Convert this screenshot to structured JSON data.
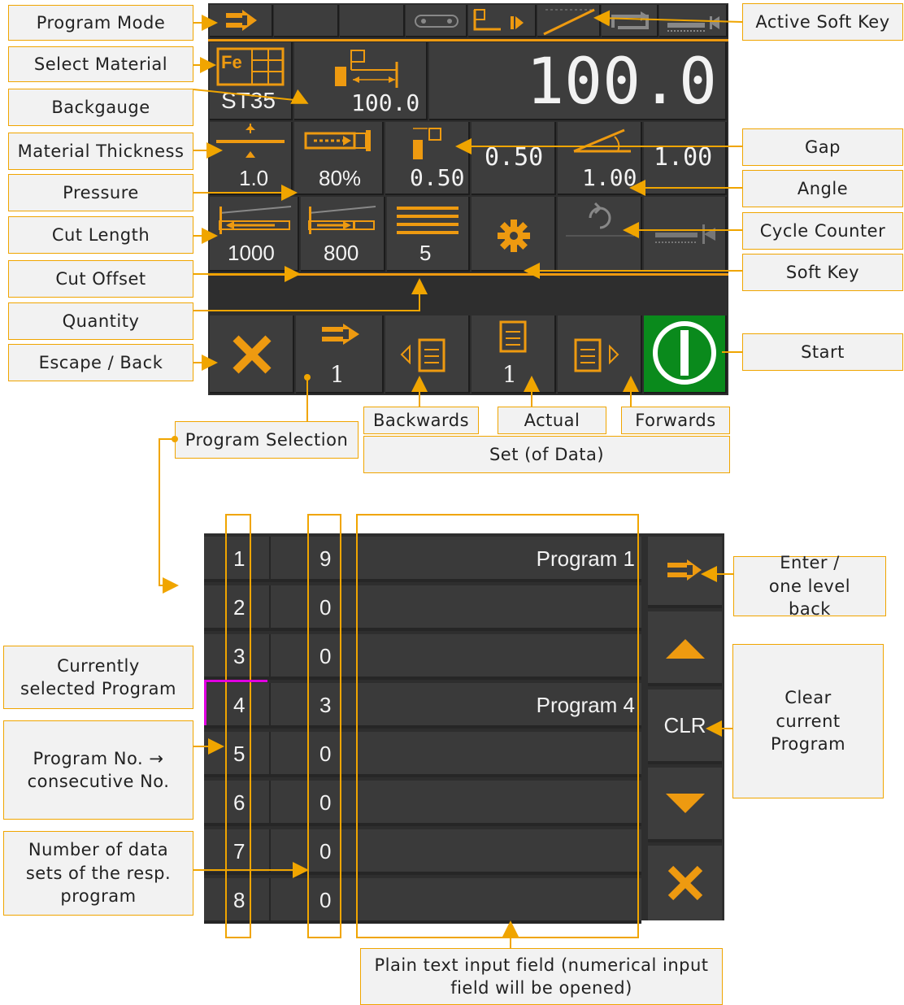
{
  "callouts": {
    "program_mode": "Program Mode",
    "select_material": "Select Material",
    "backgauge": "Backgauge",
    "material_thickness": "Material Thickness",
    "pressure": "Pressure",
    "cut_length": "Cut Length",
    "cut_offset": "Cut Offset",
    "quantity": "Quantity",
    "escape_back": "Escape / Back",
    "active_soft_key": "Active Soft Key",
    "gap": "Gap",
    "angle": "Angle",
    "cycle_counter": "Cycle Counter",
    "soft_key": "Soft Key",
    "start": "Start",
    "backwards": "Backwards",
    "actual": "Actual",
    "forwards": "Forwards",
    "program_selection": "Program Selection",
    "set_of_data": "Set (of Data)",
    "enter_one_level_back": "Enter / one level back",
    "clear_current_program": "Clear current Program",
    "currently_selected_program": "Currently selected Program",
    "program_no": "Program No. → consecutive No.",
    "number_of_data_sets": "Number of data sets of the resp. program",
    "plain_text_input": "Plain text input field (numerical input field will be opened)"
  },
  "screen": {
    "material": "ST35",
    "material_icon_text": "Fe",
    "backgauge_main": "100.0",
    "backgauge_small": "100.0",
    "thickness": "1.0",
    "pressure": "80%",
    "gap_small": "0.50",
    "gap_large": "0.50",
    "angle_small": "1.00",
    "angle_large": "1.00",
    "cut_length": "1000",
    "cut_offset": "800",
    "quantity": "5",
    "program_number": "1",
    "actual_set": "1"
  },
  "program_list": {
    "rows": [
      {
        "no": "1",
        "sets": "9",
        "name": "Program 1"
      },
      {
        "no": "2",
        "sets": "0",
        "name": ""
      },
      {
        "no": "3",
        "sets": "0",
        "name": ""
      },
      {
        "no": "4",
        "sets": "3",
        "name": "Program 4"
      },
      {
        "no": "5",
        "sets": "0",
        "name": ""
      },
      {
        "no": "6",
        "sets": "0",
        "name": ""
      },
      {
        "no": "7",
        "sets": "0",
        "name": ""
      },
      {
        "no": "8",
        "sets": "0",
        "name": ""
      }
    ],
    "selected": "4",
    "clr_label": "CLR"
  },
  "colors": {
    "accent": "#f0a500",
    "start_green": "#0a8a1c",
    "selected_magenta": "#e000e0"
  }
}
